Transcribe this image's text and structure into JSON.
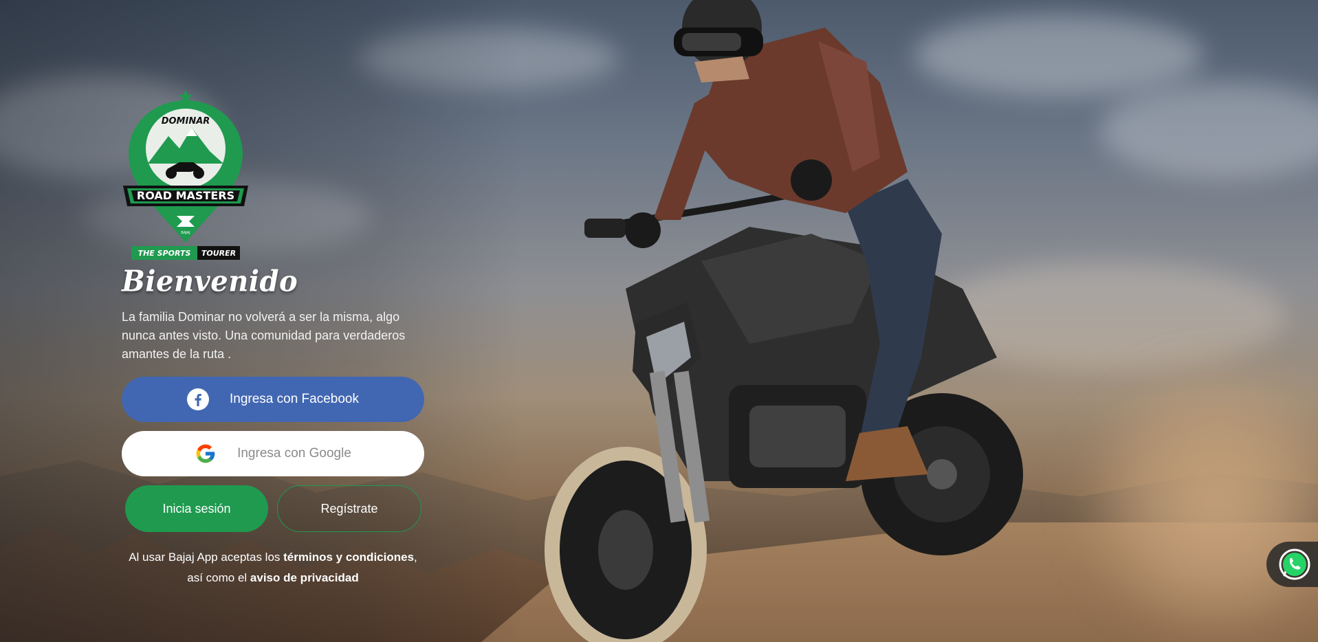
{
  "brand": {
    "logo_text_top": "DOMINAR",
    "logo_text_main": "ROAD MASTERS",
    "logo_text_maker": "BAJAJ",
    "tagline_a": "THE SPORTS",
    "tagline_b": "TOURER",
    "colors": {
      "green": "#1f9a4f",
      "facebook": "#4267b2"
    }
  },
  "welcome": {
    "title": "Bienvenido",
    "intro": "La familia Dominar no volverá a ser la misma, algo nunca antes visto. Una comunidad para verdaderos amantes de la ruta ."
  },
  "auth": {
    "facebook_label": "Ingresa con Facebook",
    "google_label": "Ingresa con Google",
    "login_label": "Inicia sesión",
    "register_label": "Regístrate"
  },
  "legal": {
    "prefix": "Al usar Bajaj App aceptas los ",
    "terms": "términos y condiciones",
    "middle": ", así como el ",
    "privacy": "aviso de privacidad"
  },
  "icons": {
    "facebook": "facebook-icon",
    "google": "google-icon",
    "whatsapp": "whatsapp-icon"
  }
}
